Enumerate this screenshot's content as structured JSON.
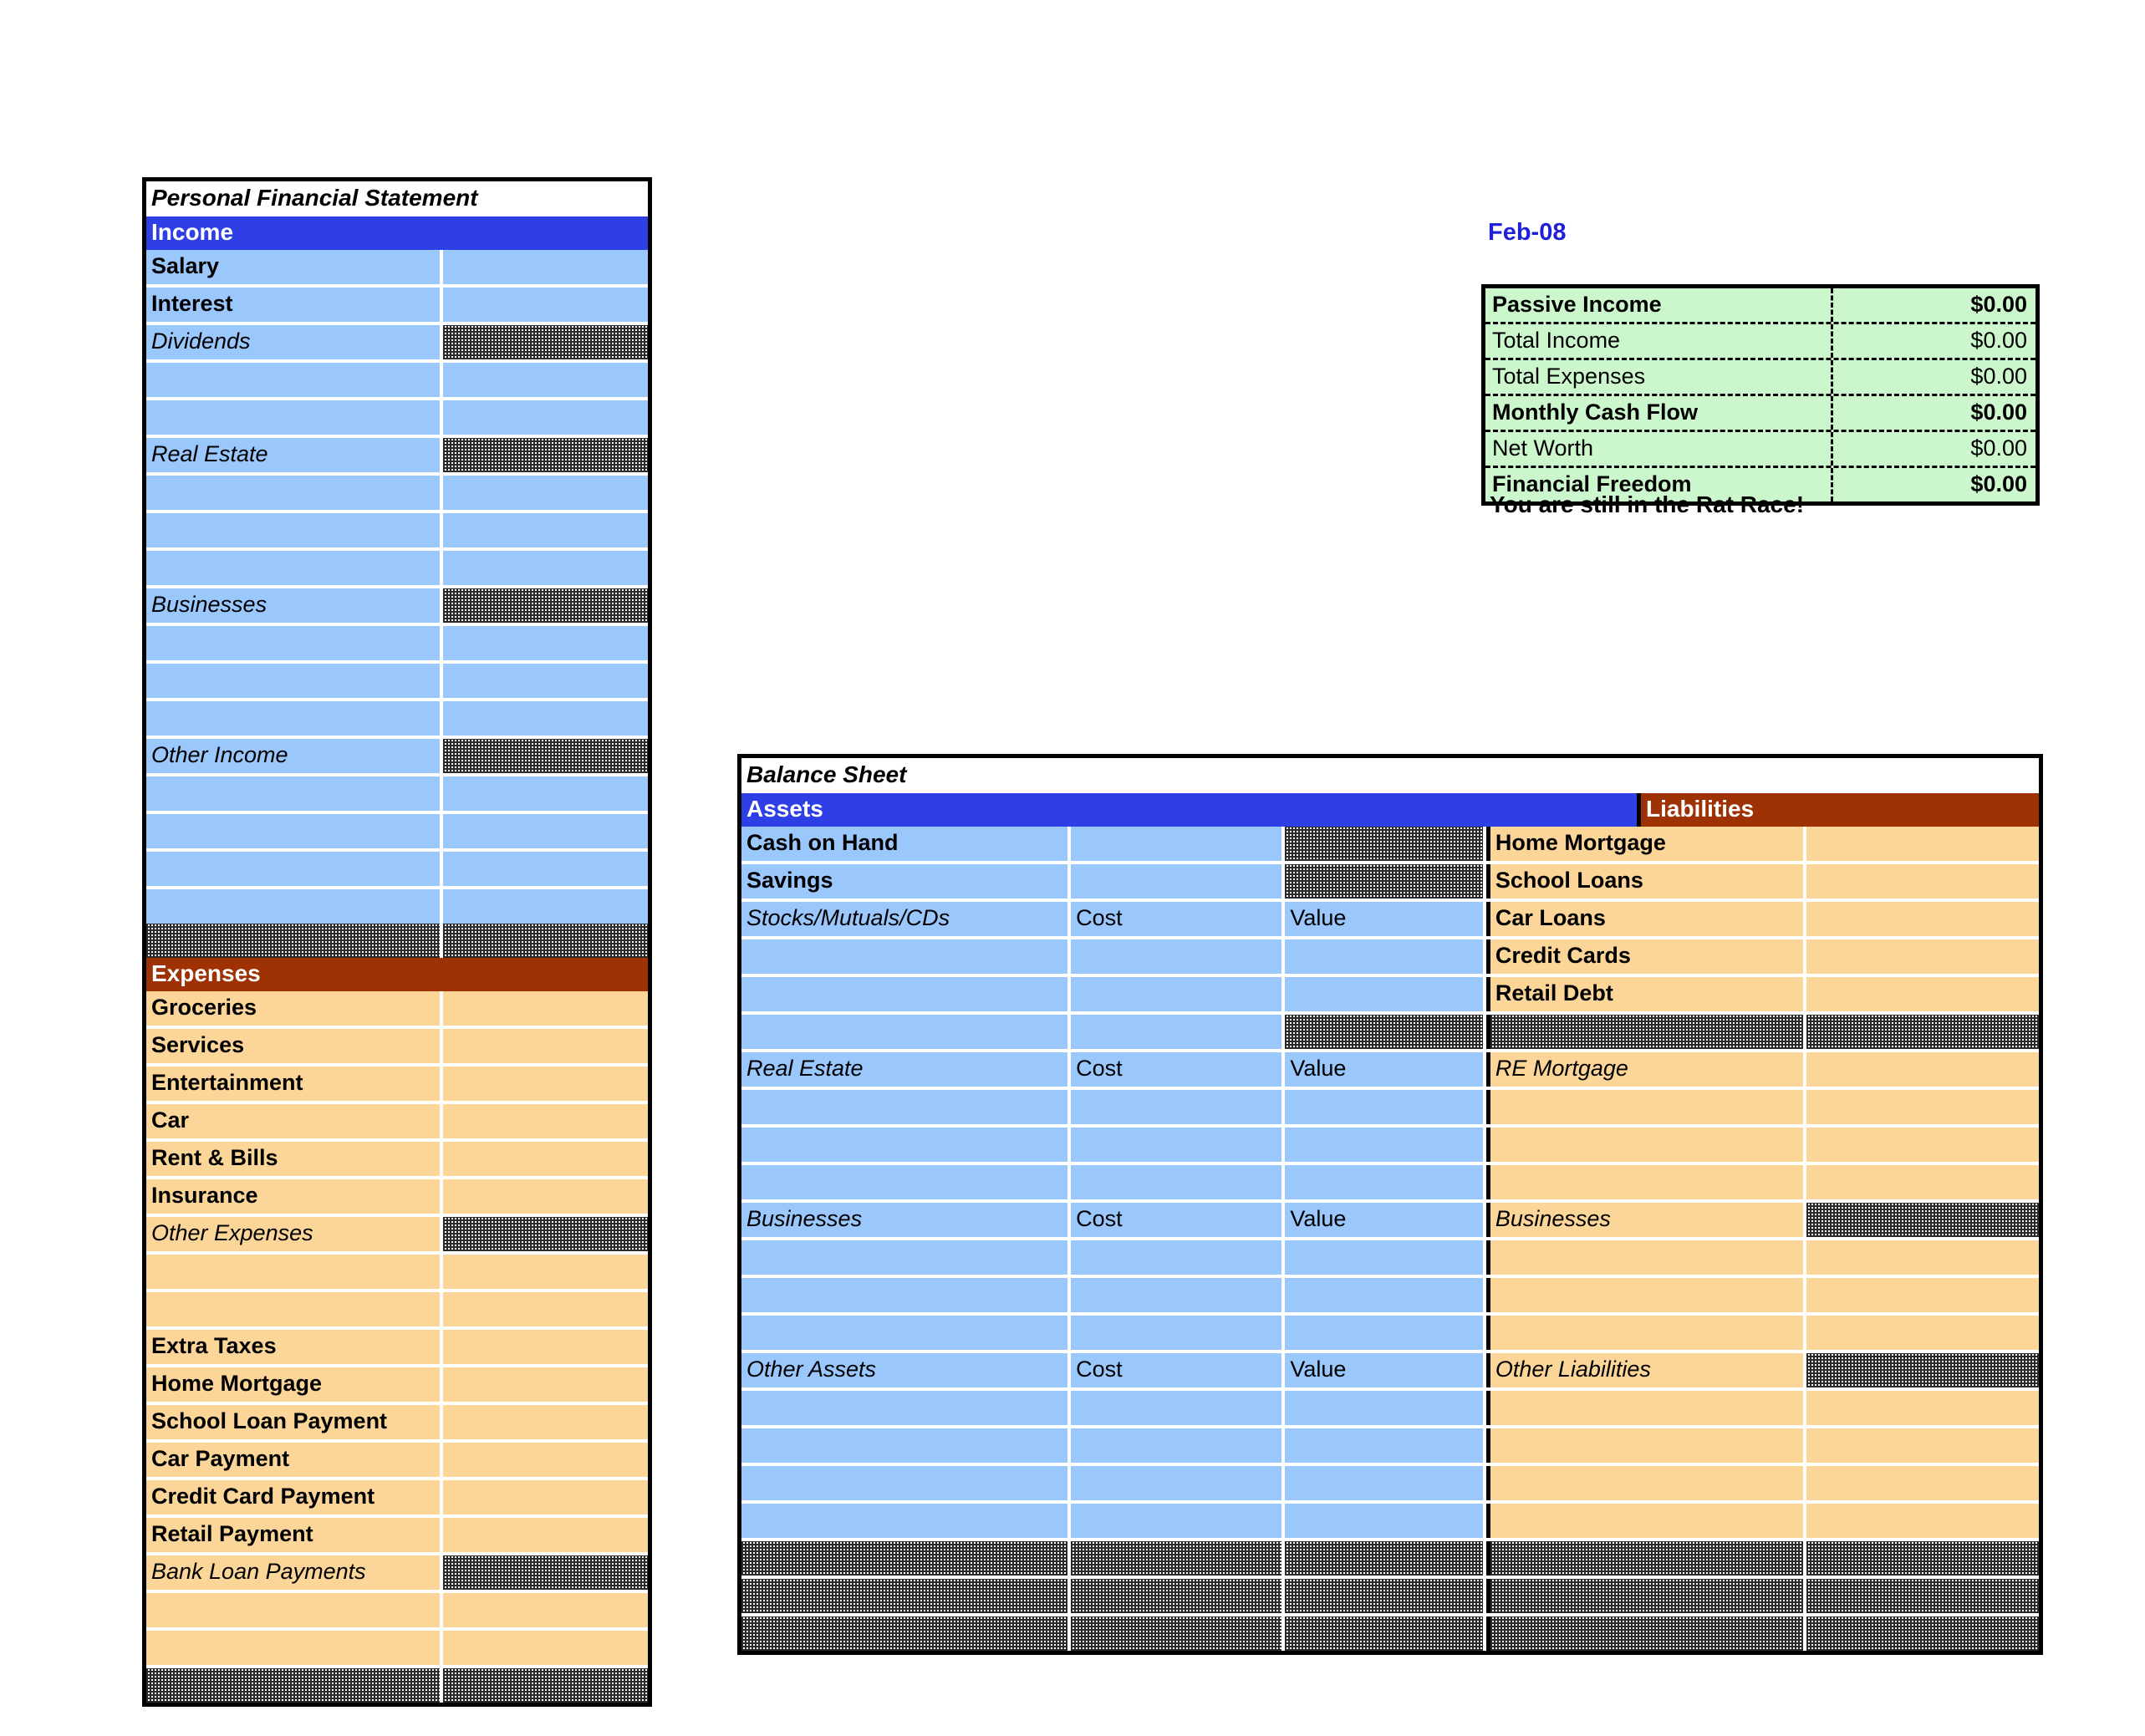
{
  "accent": {
    "blue_header": "#2e3fe6",
    "brown_header": "#9e3205",
    "blue_row": "#9ac7fc",
    "orange_row": "#fcd599",
    "green_box": "#ccf7cc",
    "period_color": "#2020d8"
  },
  "pfs": {
    "title": "Personal Financial Statement",
    "income_header": "Income",
    "income_rows": [
      {
        "label": "Salary",
        "style": "bold",
        "value": "",
        "value_locked": false
      },
      {
        "label": "Interest",
        "style": "bold",
        "value": "",
        "value_locked": false
      },
      {
        "label": "Dividends",
        "style": "italic",
        "value": "",
        "value_locked": true
      },
      {
        "label": "",
        "style": "plain",
        "value": "",
        "value_locked": false
      },
      {
        "label": "",
        "style": "plain",
        "value": "",
        "value_locked": false
      },
      {
        "label": "Real Estate",
        "style": "italic",
        "value": "",
        "value_locked": true
      },
      {
        "label": "",
        "style": "plain",
        "value": "",
        "value_locked": false
      },
      {
        "label": "",
        "style": "plain",
        "value": "",
        "value_locked": false
      },
      {
        "label": "",
        "style": "plain",
        "value": "",
        "value_locked": false
      },
      {
        "label": "Businesses",
        "style": "italic",
        "value": "",
        "value_locked": true
      },
      {
        "label": "",
        "style": "plain",
        "value": "",
        "value_locked": false
      },
      {
        "label": "",
        "style": "plain",
        "value": "",
        "value_locked": false
      },
      {
        "label": "",
        "style": "plain",
        "value": "",
        "value_locked": false
      },
      {
        "label": "Other Income",
        "style": "italic",
        "value": "",
        "value_locked": true
      },
      {
        "label": "",
        "style": "plain",
        "value": "",
        "value_locked": false
      },
      {
        "label": "",
        "style": "plain",
        "value": "",
        "value_locked": false
      },
      {
        "label": "",
        "style": "plain",
        "value": "",
        "value_locked": false
      },
      {
        "label": "",
        "style": "plain",
        "value": "",
        "value_locked": false
      }
    ],
    "income_total_locked": true,
    "expenses_header": "Expenses",
    "expense_rows": [
      {
        "label": "Groceries",
        "style": "bold",
        "value": "",
        "value_locked": false
      },
      {
        "label": "Services",
        "style": "bold",
        "value": "",
        "value_locked": false
      },
      {
        "label": "Entertainment",
        "style": "bold",
        "value": "",
        "value_locked": false
      },
      {
        "label": "Car",
        "style": "bold",
        "value": "",
        "value_locked": false
      },
      {
        "label": "Rent & Bills",
        "style": "bold",
        "value": "",
        "value_locked": false
      },
      {
        "label": "Insurance",
        "style": "bold",
        "value": "",
        "value_locked": false
      },
      {
        "label": "Other Expenses",
        "style": "italic",
        "value": "",
        "value_locked": true
      },
      {
        "label": "",
        "style": "plain",
        "value": "",
        "value_locked": false
      },
      {
        "label": "",
        "style": "plain",
        "value": "",
        "value_locked": false
      },
      {
        "label": "Extra Taxes",
        "style": "bold",
        "value": "",
        "value_locked": false
      },
      {
        "label": "Home Mortgage",
        "style": "bold",
        "value": "",
        "value_locked": false
      },
      {
        "label": "School Loan Payment",
        "style": "bold",
        "value": "",
        "value_locked": false
      },
      {
        "label": "Car Payment",
        "style": "bold",
        "value": "",
        "value_locked": false
      },
      {
        "label": "Credit Card Payment",
        "style": "bold",
        "value": "",
        "value_locked": false
      },
      {
        "label": "Retail Payment",
        "style": "bold",
        "value": "",
        "value_locked": false
      },
      {
        "label": "Bank Loan Payments",
        "style": "italic",
        "value": "",
        "value_locked": true
      },
      {
        "label": "",
        "style": "plain",
        "value": "",
        "value_locked": false
      },
      {
        "label": "",
        "style": "plain",
        "value": "",
        "value_locked": false
      }
    ],
    "expenses_total_locked": true
  },
  "summary": {
    "period": "Feb-08",
    "rows": [
      {
        "label": "Passive Income",
        "value": "$0.00",
        "emphasis": true
      },
      {
        "label": "Total Income",
        "value": "$0.00",
        "emphasis": false
      },
      {
        "label": "Total Expenses",
        "value": "$0.00",
        "emphasis": false
      },
      {
        "label": "Monthly Cash Flow",
        "value": "$0.00",
        "emphasis": true
      },
      {
        "label": "Net Worth",
        "value": "$0.00",
        "emphasis": false
      },
      {
        "label": "Financial Freedom",
        "value": "$0.00",
        "emphasis": true
      }
    ],
    "status_message": "You are still in the Rat Race!"
  },
  "balance_sheet": {
    "title": "Balance Sheet",
    "assets_header": "Assets",
    "liabilities_header": "Liabilities",
    "rows": [
      {
        "asset": "Cash on Hand",
        "asset_style": "bold",
        "a2": "",
        "a2_locked": false,
        "a3": "",
        "a3_locked": true,
        "liability": "Home Mortgage",
        "liability_style": "bold",
        "l2": "",
        "l2_locked": false
      },
      {
        "asset": "Savings",
        "asset_style": "bold",
        "a2": "",
        "a2_locked": false,
        "a3": "",
        "a3_locked": true,
        "liability": "School Loans",
        "liability_style": "bold",
        "l2": "",
        "l2_locked": false
      },
      {
        "asset": "Stocks/Mutuals/CDs",
        "asset_style": "italic",
        "a2": "Cost",
        "a2_locked": false,
        "a3": "Value",
        "a3_locked": false,
        "liability": "Car Loans",
        "liability_style": "bold",
        "l2": "",
        "l2_locked": false
      },
      {
        "asset": "",
        "asset_style": "plain",
        "a2": "",
        "a2_locked": false,
        "a3": "",
        "a3_locked": false,
        "liability": "Credit Cards",
        "liability_style": "bold",
        "l2": "",
        "l2_locked": false
      },
      {
        "asset": "",
        "asset_style": "plain",
        "a2": "",
        "a2_locked": false,
        "a3": "",
        "a3_locked": false,
        "liability": "Retail Debt",
        "liability_style": "bold",
        "l2": "",
        "l2_locked": false
      },
      {
        "asset": "",
        "asset_style": "plain",
        "a2": "",
        "a2_locked": false,
        "a3": "",
        "a3_locked": true,
        "liability": "",
        "liability_style": "locked",
        "l2": "",
        "l2_locked": true
      },
      {
        "asset": "Real Estate",
        "asset_style": "italic",
        "a2": "Cost",
        "a2_locked": false,
        "a3": "Value",
        "a3_locked": false,
        "liability": "RE Mortgage",
        "liability_style": "italic",
        "l2": "",
        "l2_locked": false
      },
      {
        "asset": "",
        "asset_style": "plain",
        "a2": "",
        "a2_locked": false,
        "a3": "",
        "a3_locked": false,
        "liability": "",
        "liability_style": "plain",
        "l2": "",
        "l2_locked": false
      },
      {
        "asset": "",
        "asset_style": "plain",
        "a2": "",
        "a2_locked": false,
        "a3": "",
        "a3_locked": false,
        "liability": "",
        "liability_style": "plain",
        "l2": "",
        "l2_locked": false
      },
      {
        "asset": "",
        "asset_style": "plain",
        "a2": "",
        "a2_locked": false,
        "a3": "",
        "a3_locked": false,
        "liability": "",
        "liability_style": "plain",
        "l2": "",
        "l2_locked": false
      },
      {
        "asset": "Businesses",
        "asset_style": "italic",
        "a2": "Cost",
        "a2_locked": false,
        "a3": "Value",
        "a3_locked": false,
        "liability": "Businesses",
        "liability_style": "italic",
        "l2": "",
        "l2_locked": true
      },
      {
        "asset": "",
        "asset_style": "plain",
        "a2": "",
        "a2_locked": false,
        "a3": "",
        "a3_locked": false,
        "liability": "",
        "liability_style": "plain",
        "l2": "",
        "l2_locked": false
      },
      {
        "asset": "",
        "asset_style": "plain",
        "a2": "",
        "a2_locked": false,
        "a3": "",
        "a3_locked": false,
        "liability": "",
        "liability_style": "plain",
        "l2": "",
        "l2_locked": false
      },
      {
        "asset": "",
        "asset_style": "plain",
        "a2": "",
        "a2_locked": false,
        "a3": "",
        "a3_locked": false,
        "liability": "",
        "liability_style": "plain",
        "l2": "",
        "l2_locked": false
      },
      {
        "asset": "Other Assets",
        "asset_style": "italic",
        "a2": "Cost",
        "a2_locked": false,
        "a3": "Value",
        "a3_locked": false,
        "liability": "Other Liabilities",
        "liability_style": "italic",
        "l2": "",
        "l2_locked": true
      },
      {
        "asset": "",
        "asset_style": "plain",
        "a2": "",
        "a2_locked": false,
        "a3": "",
        "a3_locked": false,
        "liability": "",
        "liability_style": "plain",
        "l2": "",
        "l2_locked": false
      },
      {
        "asset": "",
        "asset_style": "plain",
        "a2": "",
        "a2_locked": false,
        "a3": "",
        "a3_locked": false,
        "liability": "",
        "liability_style": "plain",
        "l2": "",
        "l2_locked": false
      },
      {
        "asset": "",
        "asset_style": "plain",
        "a2": "",
        "a2_locked": false,
        "a3": "",
        "a3_locked": false,
        "liability": "",
        "liability_style": "plain",
        "l2": "",
        "l2_locked": false
      },
      {
        "asset": "",
        "asset_style": "plain",
        "a2": "",
        "a2_locked": false,
        "a3": "",
        "a3_locked": false,
        "liability": "",
        "liability_style": "plain",
        "l2": "",
        "l2_locked": false
      }
    ],
    "footer_rows": 3
  }
}
